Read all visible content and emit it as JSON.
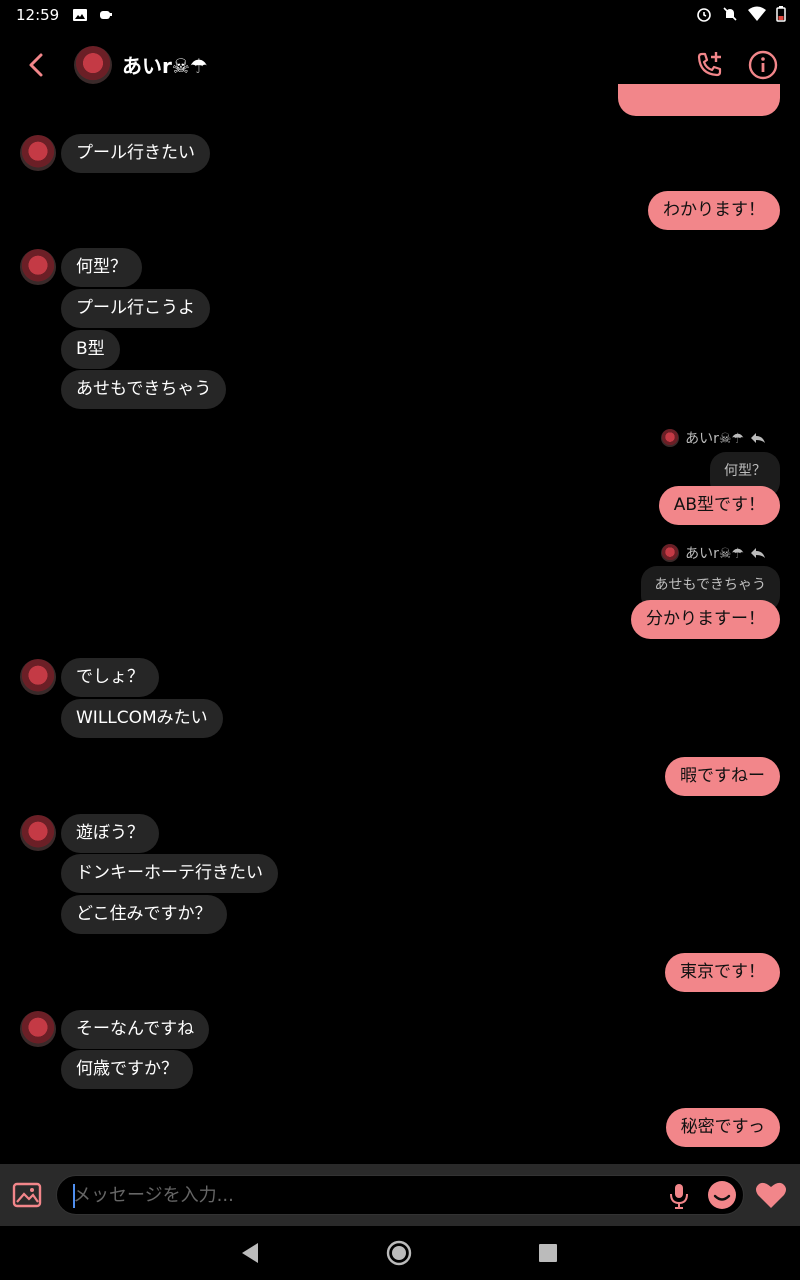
{
  "status_bar": {
    "time": "12:59"
  },
  "header": {
    "contact_name": "あいr☠☂",
    "back_icon": "chevron-left-icon",
    "call_icon": "add-call-icon",
    "info_icon": "info-icon"
  },
  "colors": {
    "accent": "#f2868a",
    "incoming_bubble": "#262626",
    "background": "#000000"
  },
  "messages": {
    "partial_top": "",
    "m1": "プール行きたい",
    "m2": "わかります！",
    "m3": "何型？",
    "m4": "プール行こうよ",
    "m5": "B型",
    "m6": "あせもできちゃう",
    "reply1_name": "あいr☠☂",
    "reply1_quote": "何型？",
    "m7": "AB型です！",
    "reply2_name": "あいr☠☂",
    "reply2_quote": "あせもできちゃう",
    "m8": "分かりますー！",
    "m9": "でしょ？",
    "m10": "WILLCOMみたい",
    "m11": "暇ですねー",
    "m12": "遊ぼう？",
    "m13": "ドンキーホーテ行きたい",
    "m14": "どこ住みですか？",
    "m15": "東京です！",
    "m16": "そーなんですね",
    "m17": "何歳ですか？",
    "m18": "秘密ですっ"
  },
  "composer": {
    "placeholder": "メッセージを入力..."
  }
}
